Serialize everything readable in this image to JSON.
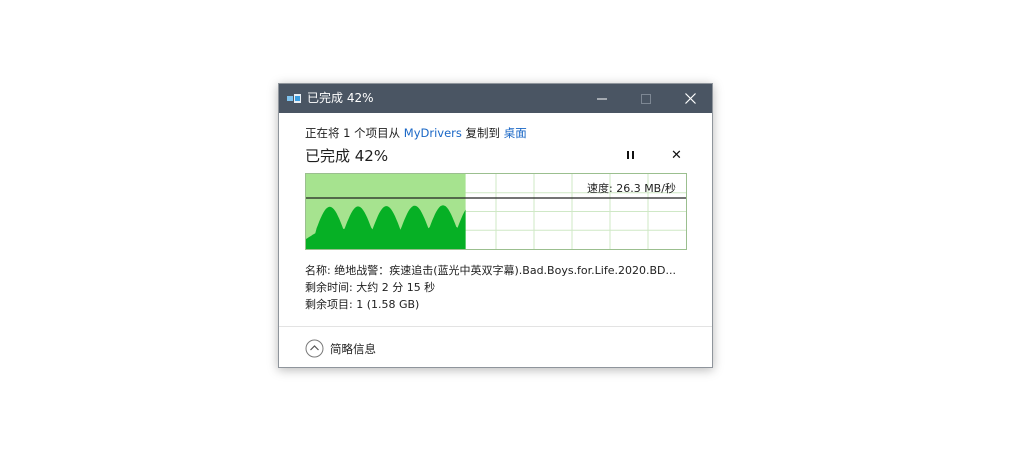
{
  "window": {
    "title": "已完成 42%",
    "colors": {
      "titlebar": "#4a5563",
      "progress_fill": "#a6e38f",
      "speed_fill": "#06b025",
      "grid": "#cfe8c6"
    }
  },
  "header": {
    "prefix": "正在将 1 个项目从 ",
    "source": "MyDrivers",
    "middle": " 复制到 ",
    "destination": "桌面"
  },
  "status": {
    "text": "已完成 42%",
    "percent": 42
  },
  "controls": {
    "pause_icon": "pause-icon",
    "cancel_icon": "close-icon"
  },
  "graph": {
    "speed_label": "速度: 26.3 MB/秒"
  },
  "details": {
    "name": "名称: 绝地战警：疾速追击(蓝光中英双字幕).Bad.Boys.for.Life.2020.BD...",
    "time_remaining": "剩余时间: 大约 2 分 15 秒",
    "items_remaining": "剩余项目: 1 (1.58 GB)"
  },
  "footer": {
    "toggle_label": "简略信息",
    "toggle_icon": "chevron-up-icon"
  }
}
